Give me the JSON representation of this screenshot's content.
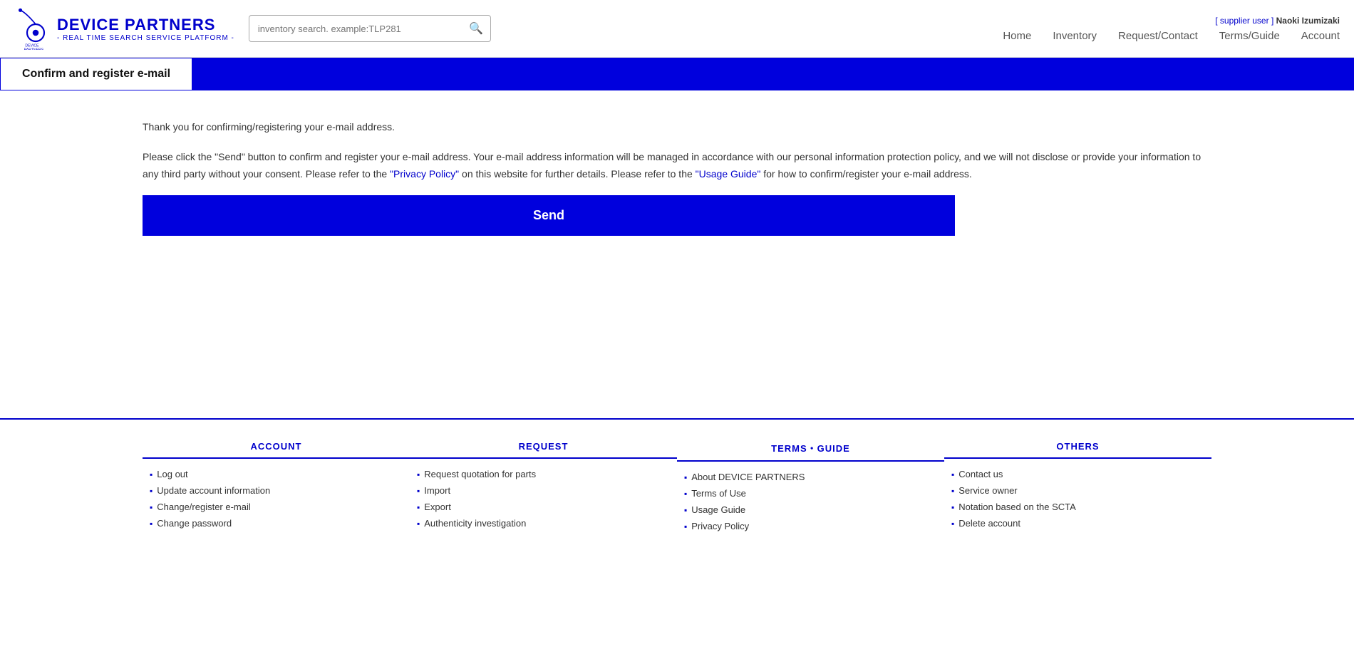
{
  "brand": {
    "name": "DEVICE PARTNERS",
    "tagline": "- REAL TIME SEARCH SERVICE PLATFORM -"
  },
  "search": {
    "placeholder": "inventory search. example:TLP281"
  },
  "user": {
    "role_label": "[ supplier user ]",
    "username": "Naoki Izumizaki"
  },
  "nav": {
    "home": "Home",
    "inventory": "Inventory",
    "request_contact": "Request/Contact",
    "terms_guide": "Terms/Guide",
    "account": "Account"
  },
  "banner": {
    "tab_label": "Confirm and register e-mail"
  },
  "main": {
    "paragraph1": "Thank you for confirming/registering your e-mail address.",
    "paragraph2_before": "Please click the \"Send\" button to confirm and register your e-mail address. Your e-mail address information will be managed in accordance with our personal information protection policy, and we will not disclose or provide your information to any third party without your consent. Please refer to the",
    "privacy_policy_link": "\"Privacy Policy\"",
    "paragraph2_middle": "on this website for further details. Please refer to the",
    "usage_guide_link": "\"Usage Guide\"",
    "paragraph2_after": "for how to confirm/register your e-mail address.",
    "send_button": "Send"
  },
  "footer": {
    "account": {
      "title": "ACCOUNT",
      "items": [
        "Log out",
        "Update account information",
        "Change/register e-mail",
        "Change password"
      ]
    },
    "request": {
      "title": "REQUEST",
      "items": [
        "Request quotation for parts",
        "Import",
        "Export",
        "Authenticity investigation"
      ]
    },
    "terms": {
      "title": "TERMS・GUIDE",
      "items": [
        "About DEVICE PARTNERS",
        "Terms of Use",
        "Usage Guide",
        "Privacy Policy"
      ]
    },
    "others": {
      "title": "OTHERS",
      "items": [
        "Contact us",
        "Service owner",
        "Notation based on the SCTA",
        "Delete account"
      ]
    }
  }
}
